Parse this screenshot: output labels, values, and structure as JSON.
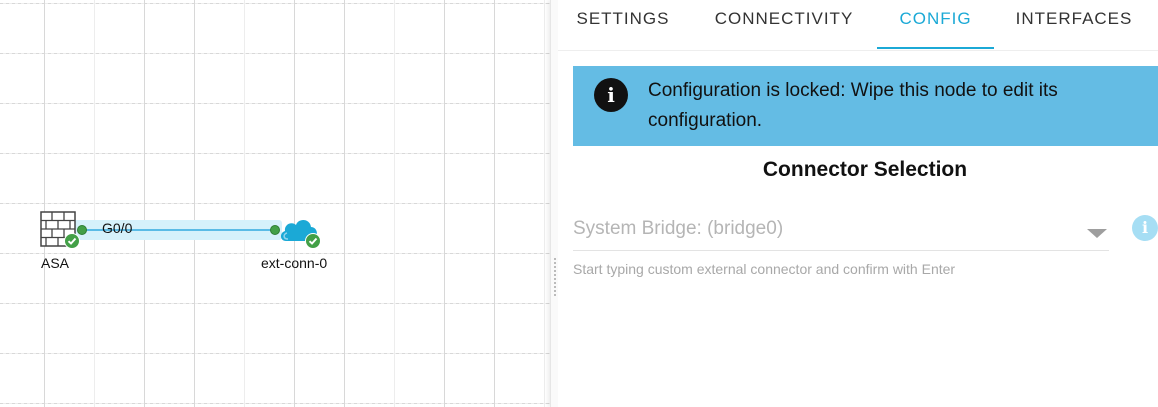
{
  "canvas": {
    "link": {
      "label": "G0/0"
    },
    "nodes": [
      {
        "label": "ASA",
        "icon": "firewall-icon",
        "status": "check-icon"
      },
      {
        "label": "ext-conn-0",
        "icon": "cloud-icon",
        "status": "check-icon"
      }
    ]
  },
  "tabs": [
    {
      "label": "SETTINGS"
    },
    {
      "label": "CONNECTIVITY"
    },
    {
      "label": "CONFIG",
      "active": true
    },
    {
      "label": "INTERFACES"
    }
  ],
  "banner": {
    "icon": "info-icon",
    "message": "Configuration is locked: Wipe this node to edit its configuration.",
    "color": "#64bce4"
  },
  "connector": {
    "title": "Connector Selection",
    "select_value": "System Bridge: (bridge0)",
    "helper": "Start typing custom external connector and confirm with Enter"
  },
  "colors": {
    "accent": "#1ba9d6",
    "status_ok": "#43a047",
    "link": "#5bbbe6"
  }
}
